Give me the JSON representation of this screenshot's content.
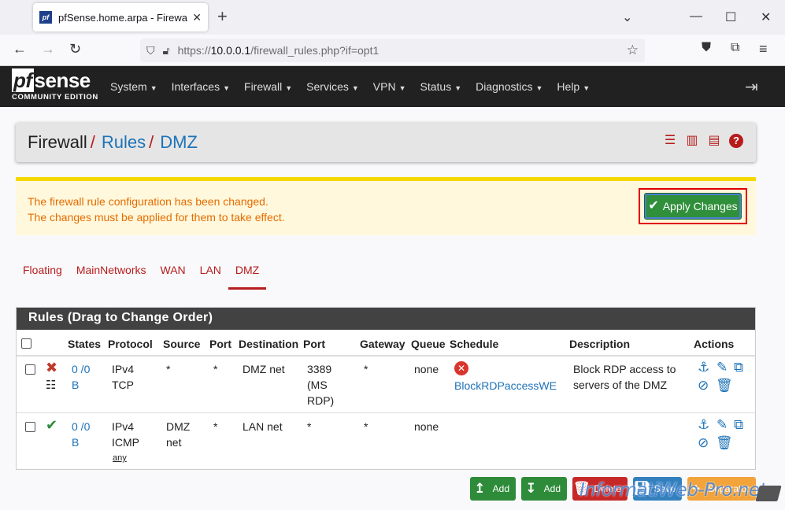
{
  "browser": {
    "tab_title": "pfSense.home.arpa - Firewall: R",
    "favicon_text": "pf",
    "url_prefix": "https://",
    "url_host": "10.0.0.1",
    "url_path": "/firewall_rules.php?if=opt1"
  },
  "pfsense": {
    "logo_main": "sense",
    "logo_pf": "pf",
    "logo_sub": "COMMUNITY EDITION",
    "menu": [
      "System",
      "Interfaces",
      "Firewall",
      "Services",
      "VPN",
      "Status",
      "Diagnostics",
      "Help"
    ]
  },
  "breadcrumb": {
    "first": "Firewall",
    "second": "Rules",
    "third": "DMZ"
  },
  "alert": {
    "line1": "The firewall rule configuration has been changed.",
    "line2": "The changes must be applied for them to take effect.",
    "apply_label": "Apply Changes"
  },
  "subtabs": [
    "Floating",
    "MainNetworks",
    "WAN",
    "LAN",
    "DMZ"
  ],
  "rules": {
    "title": "Rules (Drag to Change Order)",
    "columns": [
      "States",
      "Protocol",
      "Source",
      "Port",
      "Destination",
      "Port",
      "Gateway",
      "Queue",
      "Schedule",
      "Description",
      "Actions"
    ],
    "rows": [
      {
        "states_a": "0 /0",
        "states_b": "B",
        "protocol_a": "IPv4",
        "protocol_b": "TCP",
        "source": "*",
        "source_port": "*",
        "destination": "DMZ net",
        "dest_port_a": "3389",
        "dest_port_b": "(MS",
        "dest_port_c": "RDP)",
        "gateway": "*",
        "queue": "none",
        "schedule": "BlockRDPaccessWE",
        "description_a": "Block RDP access to",
        "description_b": "servers of the DMZ"
      },
      {
        "states_a": "0 /0",
        "states_b": "B",
        "protocol_a": "IPv4",
        "protocol_b": "ICMP",
        "protocol_c": "any",
        "source_a": "DMZ",
        "source_b": "net",
        "source_port": "*",
        "destination": "LAN net",
        "dest_port": "*",
        "gateway": "*",
        "queue": "none"
      }
    ]
  },
  "buttons": {
    "add_top": "Add",
    "add_bottom": "Add",
    "delete": "Delete",
    "save": "Save",
    "separator": "Separator"
  },
  "watermark": "InformatiWeb-Pro.net",
  "colors": {
    "accent_red": "#b71c1c",
    "link_blue": "#1e73b8",
    "apply_green": "#2f8f3a",
    "alert_text": "#e56b00"
  }
}
